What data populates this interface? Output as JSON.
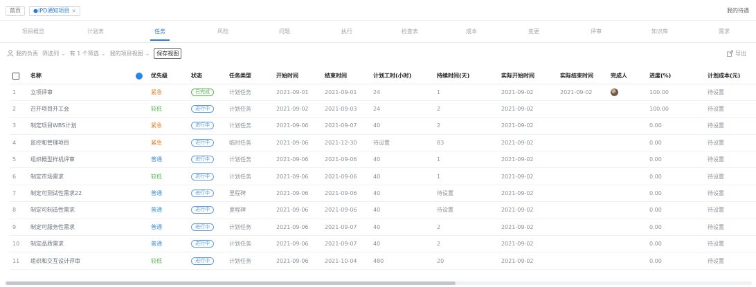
{
  "colors": {
    "accent": "#2a7dd6",
    "urgent": "#e57b1f",
    "low": "#52b64f",
    "normal": "#3d8fe0",
    "status_done": "#52b64f",
    "status_progress": "#5b9be6"
  },
  "header": {
    "home_tab": "首页",
    "active_tab": "●IPD通知项目",
    "close_glyph": "×",
    "right_link": "我的待遇"
  },
  "nav_tabs": [
    {
      "label": "项目概览",
      "active": false
    },
    {
      "label": "计划表",
      "active": false
    },
    {
      "label": "任务",
      "active": true
    },
    {
      "label": "风险",
      "active": false
    },
    {
      "label": "问题",
      "active": false
    },
    {
      "label": "执行",
      "active": false
    },
    {
      "label": "检查表",
      "active": false
    },
    {
      "label": "成本",
      "active": false
    },
    {
      "label": "变更",
      "active": false
    },
    {
      "label": "评审",
      "active": false
    },
    {
      "label": "知识库",
      "active": false
    },
    {
      "label": "需求",
      "active": false
    }
  ],
  "toolbar": {
    "filter_owner": "我的负责",
    "filter_cols": "筛选列",
    "filter_conditions": "有 1 个筛选",
    "filter_view": "我的项目视图",
    "save_view": "保存视图",
    "export": "导出"
  },
  "table": {
    "columns": [
      "名称",
      "优先级",
      "状态",
      "任务类型",
      "开始时间",
      "结束时间",
      "计划工时(小时)",
      "持续时间(天)",
      "实际开始时间",
      "实际结束时间",
      "完成人",
      "进度(%)",
      "计划成本(元)"
    ],
    "rows": [
      {
        "no": "1",
        "name": "立项评审",
        "priority": "紧急",
        "pri_level": "urgent",
        "status": "已完成",
        "status_type": "done",
        "type": "计划任务",
        "start": "2021-09-01",
        "end": "2021-09-01",
        "hours": "24",
        "days": "1",
        "act_start": "2021-09-02",
        "act_end": "2021-09-02",
        "avatar": true,
        "progress": "100.00",
        "cost": "待设置"
      },
      {
        "no": "2",
        "name": "召开项目开工会",
        "priority": "较低",
        "pri_level": "low",
        "status": "进行中",
        "status_type": "progress",
        "type": "计划任务",
        "start": "2021-09-02",
        "end": "2021-09-03",
        "hours": "24",
        "days": "2",
        "act_start": "2021-09-02",
        "act_end": "",
        "avatar": false,
        "progress": "100.00",
        "cost": "待设置"
      },
      {
        "no": "3",
        "name": "制定项目WBS计划",
        "priority": "紧急",
        "pri_level": "urgent",
        "status": "进行中",
        "status_type": "progress",
        "type": "计划任务",
        "start": "2021-09-06",
        "end": "2021-09-07",
        "hours": "40",
        "days": "2",
        "act_start": "2021-09-02",
        "act_end": "",
        "avatar": false,
        "progress": "0.00",
        "cost": "待设置"
      },
      {
        "no": "4",
        "name": "监控和管理项目",
        "priority": "紧急",
        "pri_level": "urgent",
        "status": "进行中",
        "status_type": "progress",
        "type": "临时任务",
        "start": "2021-09-06",
        "end": "2021-12-30",
        "hours": "待设置",
        "days": "83",
        "act_start": "2021-09-02",
        "act_end": "",
        "avatar": false,
        "progress": "0.00",
        "cost": "待设置"
      },
      {
        "no": "5",
        "name": "组织概型样机评审",
        "priority": "普通",
        "pri_level": "normal",
        "status": "进行中",
        "status_type": "progress",
        "type": "计划任务",
        "start": "2021-09-06",
        "end": "2021-09-06",
        "hours": "40",
        "days": "1",
        "act_start": "2021-09-02",
        "act_end": "",
        "avatar": false,
        "progress": "0.00",
        "cost": "待设置"
      },
      {
        "no": "6",
        "name": "制定市场需求",
        "priority": "较低",
        "pri_level": "low",
        "status": "进行中",
        "status_type": "progress",
        "type": "计划任务",
        "start": "2021-09-06",
        "end": "2021-09-06",
        "hours": "40",
        "days": "1",
        "act_start": "2021-09-02",
        "act_end": "",
        "avatar": false,
        "progress": "0.00",
        "cost": "待设置"
      },
      {
        "no": "7",
        "name": "制定可测试性需求22",
        "priority": "普通",
        "pri_level": "normal",
        "status": "进行中",
        "status_type": "progress",
        "type": "里程碑",
        "start": "2021-09-06",
        "end": "2021-09-06",
        "hours": "40",
        "days": "待设置",
        "act_start": "2021-09-02",
        "act_end": "",
        "avatar": false,
        "progress": "0.00",
        "cost": "待设置"
      },
      {
        "no": "8",
        "name": "制定可制造性需求",
        "priority": "普通",
        "pri_level": "normal",
        "status": "进行中",
        "status_type": "progress",
        "type": "里程碑",
        "start": "2021-09-06",
        "end": "2021-09-06",
        "hours": "40",
        "days": "待设置",
        "act_start": "2021-09-02",
        "act_end": "",
        "avatar": false,
        "progress": "0.00",
        "cost": "待设置"
      },
      {
        "no": "9",
        "name": "制定可服务性需求",
        "priority": "普通",
        "pri_level": "normal",
        "status": "进行中",
        "status_type": "progress",
        "type": "计划任务",
        "start": "2021-09-06",
        "end": "2021-09-07",
        "hours": "40",
        "days": "2",
        "act_start": "2021-09-02",
        "act_end": "",
        "avatar": false,
        "progress": "0.00",
        "cost": "待设置"
      },
      {
        "no": "10",
        "name": "制定品质需求",
        "priority": "普通",
        "pri_level": "normal",
        "status": "进行中",
        "status_type": "progress",
        "type": "计划任务",
        "start": "2021-09-06",
        "end": "2021-09-07",
        "hours": "40",
        "days": "2",
        "act_start": "2021-09-02",
        "act_end": "",
        "avatar": false,
        "progress": "0.00",
        "cost": "待设置"
      },
      {
        "no": "11",
        "name": "组织和交互设计评审",
        "priority": "较低",
        "pri_level": "low",
        "status": "进行中",
        "status_type": "progress",
        "type": "计划任务",
        "start": "2021-09-06",
        "end": "2021-10-04",
        "hours": "480",
        "days": "20",
        "act_start": "2021-09-02",
        "act_end": "",
        "avatar": false,
        "progress": "0.00",
        "cost": "待设置"
      }
    ]
  }
}
